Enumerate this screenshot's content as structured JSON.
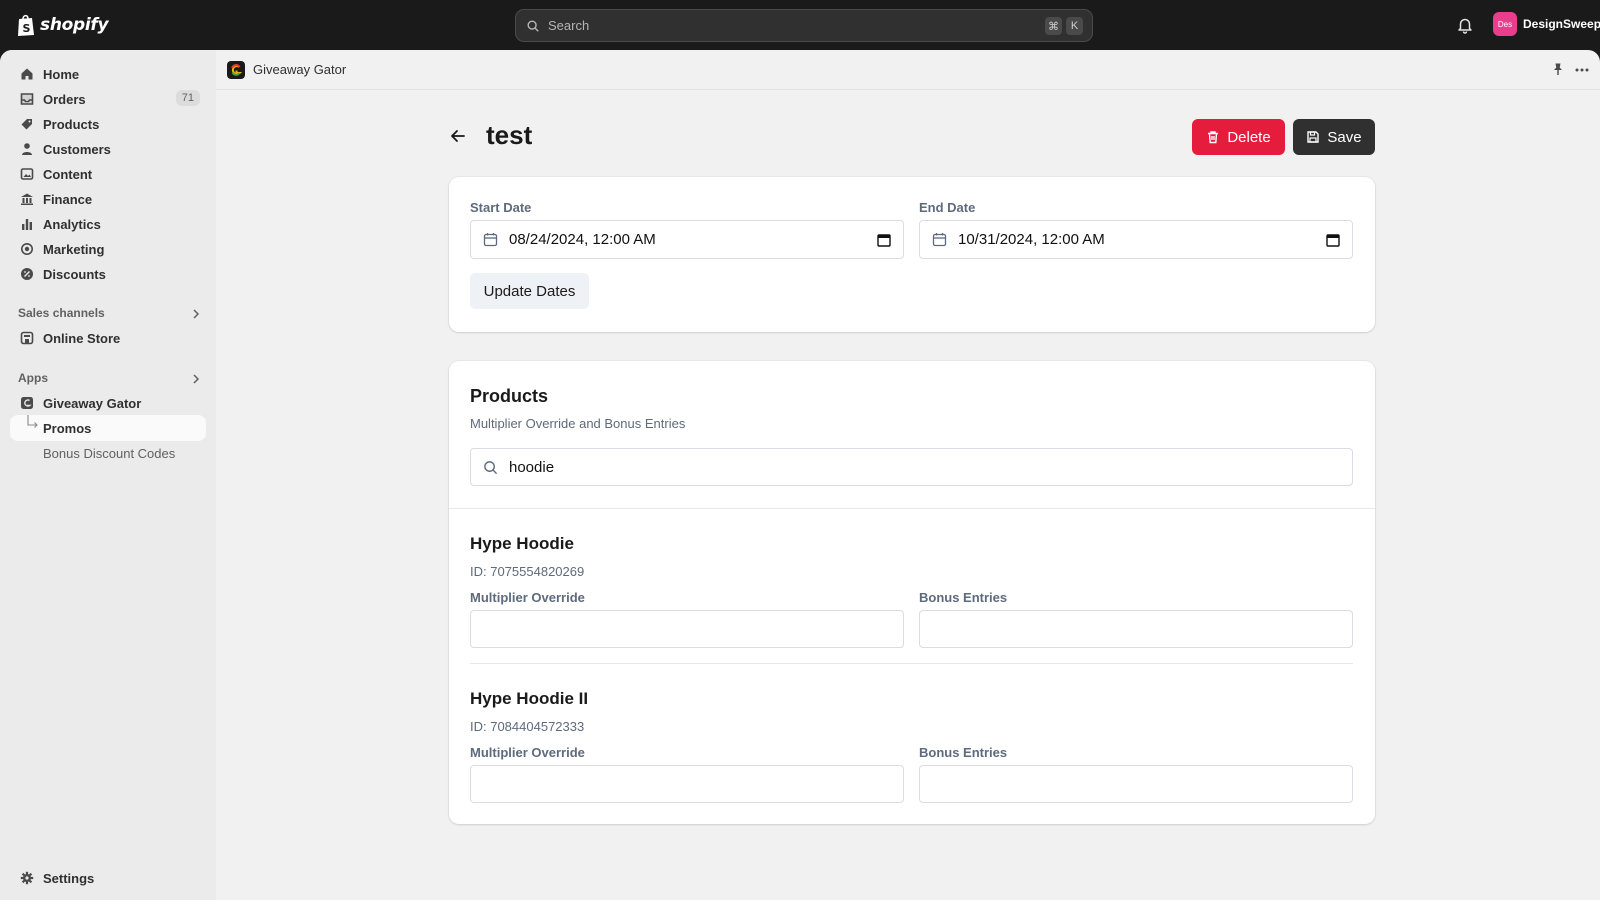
{
  "topbar": {
    "logo_text": "shopify",
    "search_placeholder": "Search",
    "shortcut_keys": [
      "⌘",
      "K"
    ],
    "user_initials": "Des",
    "user_name": "DesignSweep"
  },
  "sidebar": {
    "items": [
      {
        "label": "Home",
        "icon": "home-icon"
      },
      {
        "label": "Orders",
        "icon": "orders-icon",
        "badge": "71"
      },
      {
        "label": "Products",
        "icon": "tag-icon"
      },
      {
        "label": "Customers",
        "icon": "person-icon"
      },
      {
        "label": "Content",
        "icon": "content-icon"
      },
      {
        "label": "Finance",
        "icon": "bank-icon"
      },
      {
        "label": "Analytics",
        "icon": "bar-chart-icon"
      },
      {
        "label": "Marketing",
        "icon": "target-icon"
      },
      {
        "label": "Discounts",
        "icon": "discount-icon"
      }
    ],
    "sales_channels_title": "Sales channels",
    "online_store": "Online Store",
    "apps_title": "Apps",
    "app_name": "Giveaway Gator",
    "app_subitems": [
      "Promos",
      "Bonus Discount Codes"
    ],
    "settings": "Settings"
  },
  "app_header": {
    "name": "Giveaway Gator"
  },
  "page": {
    "title": "test",
    "delete_label": "Delete",
    "save_label": "Save"
  },
  "dates": {
    "start_label": "Start Date",
    "start_value": "08/24/2024, 12:00 AM",
    "end_label": "End Date",
    "end_value": "10/31/2024, 12:00 AM",
    "update_label": "Update Dates"
  },
  "products": {
    "title": "Products",
    "subtitle": "Multiplier Override and Bonus Entries",
    "search_value": "hoodie",
    "items": [
      {
        "name": "Hype Hoodie",
        "id": "ID: 7075554820269",
        "multiplier_label": "Multiplier Override",
        "bonus_label": "Bonus Entries"
      },
      {
        "name": "Hype Hoodie II",
        "id": "ID: 7084404572333",
        "multiplier_label": "Multiplier Override",
        "bonus_label": "Bonus Entries"
      }
    ]
  },
  "colors": {
    "delete": "#e51c3c",
    "save": "#303030",
    "topbar": "#1a1a1a",
    "avatar": "#e83e8c"
  }
}
